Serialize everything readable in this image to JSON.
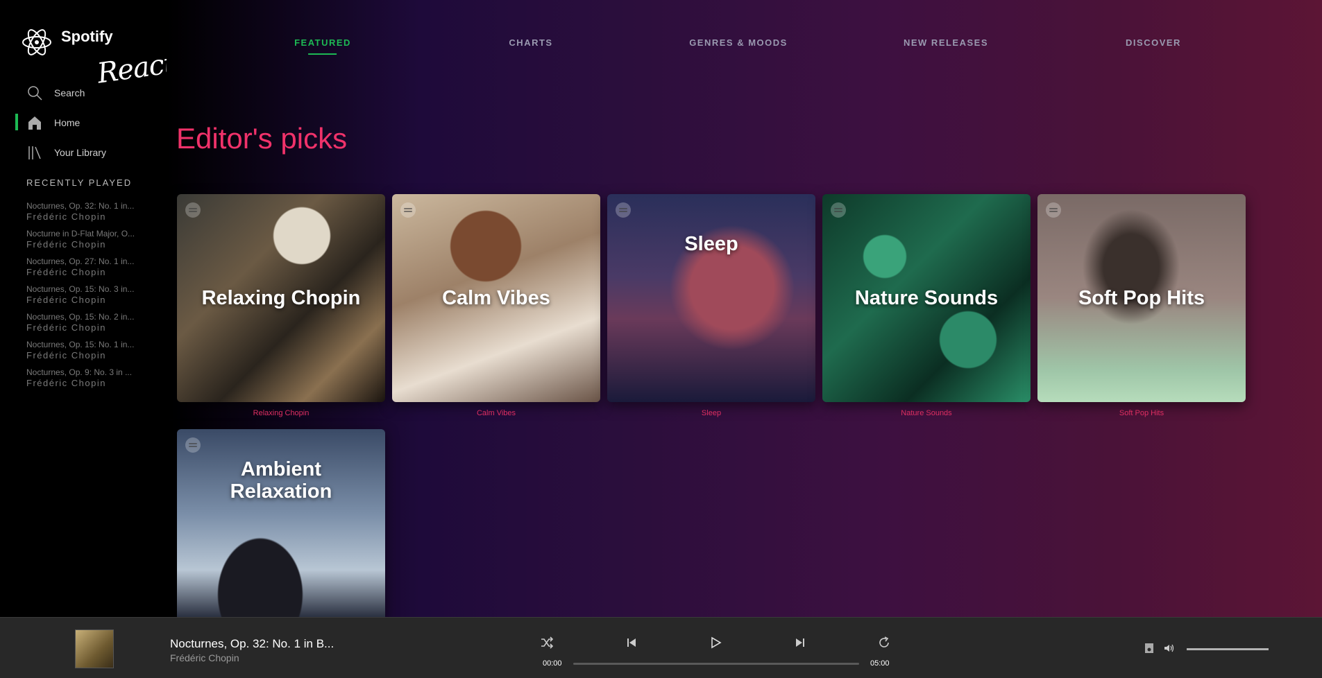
{
  "app": {
    "name": "Spotify",
    "subtitle": "React"
  },
  "sidebar": {
    "nav": [
      {
        "label": "Search",
        "icon": "search-icon"
      },
      {
        "label": "Home",
        "icon": "home-icon",
        "active": true
      },
      {
        "label": "Your Library",
        "icon": "library-icon"
      }
    ],
    "recent_title": "RECENTLY PLAYED",
    "recent": [
      {
        "title": "Nocturnes, Op. 32: No. 1 in...",
        "artist": "Frédéric Chopin"
      },
      {
        "title": "Nocturne in D-Flat Major, O...",
        "artist": "Frédéric Chopin"
      },
      {
        "title": "Nocturnes, Op. 27: No. 1 in...",
        "artist": "Frédéric Chopin"
      },
      {
        "title": "Nocturnes, Op. 15: No. 3 in...",
        "artist": "Frédéric Chopin"
      },
      {
        "title": "Nocturnes, Op. 15: No. 2 in...",
        "artist": "Frédéric Chopin"
      },
      {
        "title": "Nocturnes, Op. 15: No. 1 in...",
        "artist": "Frédéric Chopin"
      },
      {
        "title": "Nocturnes, Op. 9: No. 3 in ...",
        "artist": "Frédéric Chopin"
      }
    ]
  },
  "tabs": [
    "FEATURED",
    "CHARTS",
    "GENRES & MOODS",
    "NEW RELEASES",
    "DISCOVER"
  ],
  "active_tab": "FEATURED",
  "heading": "Editor's picks",
  "playlists": [
    {
      "title": "Relaxing Chopin",
      "caption": "Relaxing Chopin"
    },
    {
      "title": "Calm Vibes",
      "caption": "Calm Vibes"
    },
    {
      "title": "Sleep",
      "caption": "Sleep"
    },
    {
      "title": "Nature Sounds",
      "caption": "Nature Sounds"
    },
    {
      "title": "Soft Pop Hits",
      "caption": "Soft Pop Hits"
    },
    {
      "title": "Ambient Relaxation",
      "caption": ""
    }
  ],
  "player": {
    "track": "Nocturnes, Op. 32: No. 1 in B...",
    "artist": "Frédéric Chopin",
    "elapsed": "00:00",
    "duration": "05:00",
    "progress": 0,
    "volume": 1.0
  },
  "colors": {
    "accent": "#1db954",
    "heading": "#f0326a"
  }
}
